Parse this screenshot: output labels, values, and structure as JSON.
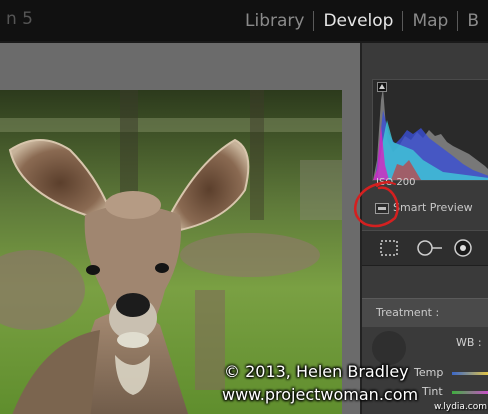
{
  "app": {
    "version_fragment": "n 5"
  },
  "modules": [
    {
      "label": "Library",
      "active": false
    },
    {
      "label": "Develop",
      "active": true
    },
    {
      "label": "Map",
      "active": false
    },
    {
      "label": "B",
      "active": false
    }
  ],
  "histogram": {
    "info": "ISO 200"
  },
  "smart_preview": {
    "label": "Smart Preview",
    "annotation_color": "#d42020"
  },
  "tools": [
    {
      "name": "crop-overlay-tool"
    },
    {
      "name": "spot-removal-tool"
    },
    {
      "name": "red-eye-tool"
    }
  ],
  "basic": {
    "treatment_label": "Treatment :",
    "wb_label": "WB :",
    "temp_label": "Temp",
    "tint_label": "Tint"
  },
  "watermark": {
    "copyright": "© 2013, Helen Bradley",
    "url": "www.projectwoman.com",
    "site_small": "w.lydia.com"
  },
  "colors": {
    "panel_bg": "#3a3a3a",
    "canvas_bg": "#6b6b6b",
    "topbar_bg": "#111111",
    "active_module": "#e6e6e6",
    "inactive_module": "#8a8a8a"
  }
}
